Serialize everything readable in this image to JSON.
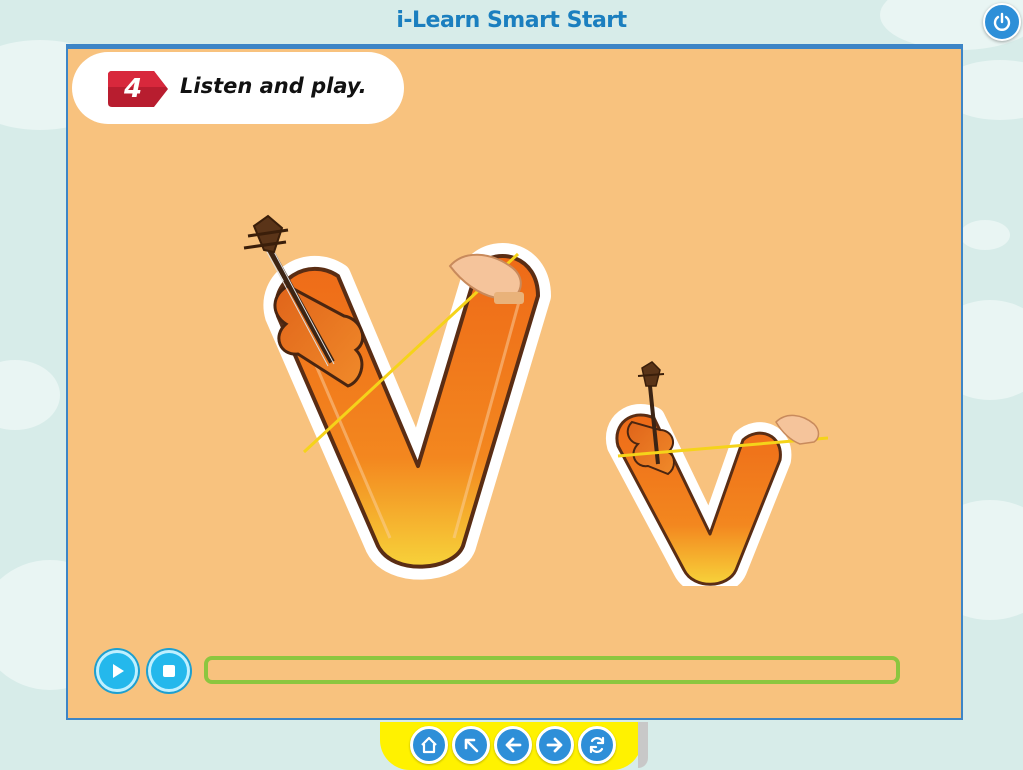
{
  "app": {
    "title": "i-Learn Smart Start"
  },
  "activity": {
    "number": "4",
    "instruction": "Listen and play."
  },
  "illustration": {
    "letters": [
      "V",
      "v"
    ],
    "icons": [
      "violin-icon",
      "hand-icon",
      "bow-icon"
    ]
  },
  "player": {
    "play_icon": "play-icon",
    "stop_icon": "stop-icon",
    "progress": 0
  },
  "nav": {
    "buttons": [
      "home-icon",
      "back-to-menu-icon",
      "previous-icon",
      "next-icon",
      "refresh-icon"
    ]
  },
  "colors": {
    "background": "#d7ece9",
    "stage": "#f8c27e",
    "accent_blue": "#2e8fd8",
    "progress_green": "#8cc63f",
    "nav_yellow": "#fff200",
    "badge_red": "#d8283c",
    "letter_orange": "#f07a1a"
  }
}
